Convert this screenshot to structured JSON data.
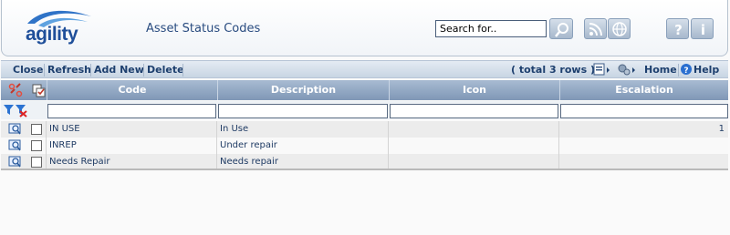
{
  "header": {
    "logo_text": "agility",
    "title": "Asset Status Codes",
    "search_placeholder": "Search for.."
  },
  "toolbar": {
    "close_label": "Close",
    "refresh_label": "Refresh",
    "add_new_label": "Add New",
    "delete_label": "Delete",
    "rows_count": "( total 3 rows )",
    "home_label": "Home",
    "help_label": "Help"
  },
  "grid": {
    "columns": [
      "Code",
      "Description",
      "Icon",
      "Escalation"
    ],
    "rows": [
      {
        "code": "IN USE",
        "description": "In Use",
        "icon": "",
        "escalation": "1"
      },
      {
        "code": "INREP",
        "description": "Under repair",
        "icon": "",
        "escalation": ""
      },
      {
        "code": "Needs Repair",
        "description": "Needs repair",
        "icon": "",
        "escalation": ""
      }
    ]
  },
  "colors": {
    "brand_blue": "#1f4f9a",
    "header_grid": "#8ea4c0",
    "toolbar_text": "#1d3f6e"
  }
}
